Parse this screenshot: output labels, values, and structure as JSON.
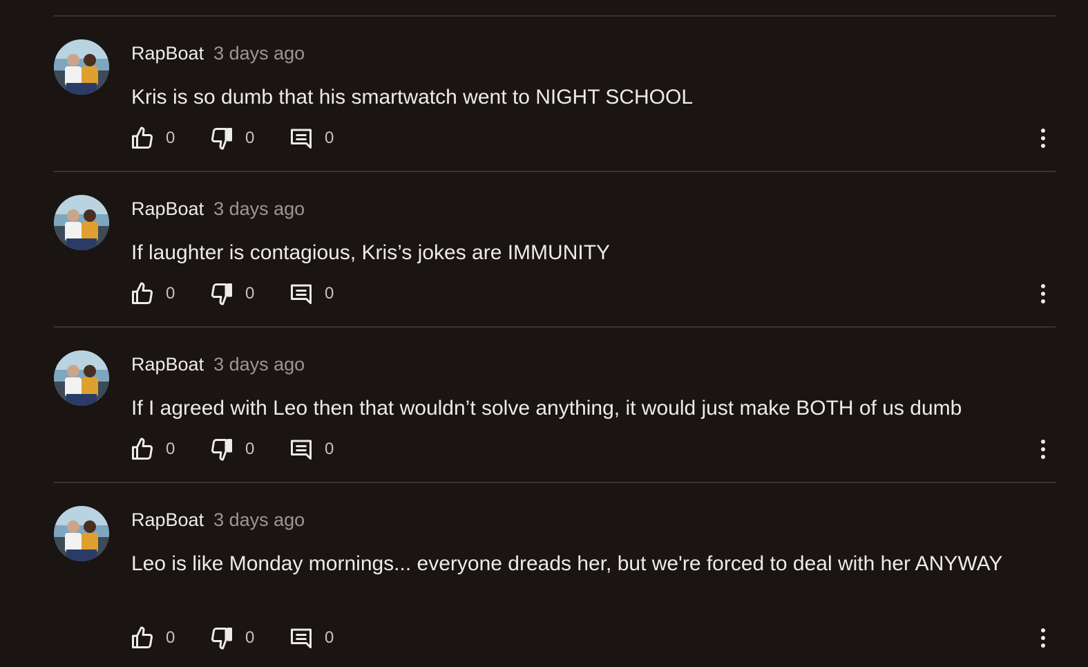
{
  "comments": [
    {
      "author": "RapBoat",
      "time": "3 days ago",
      "text": "Kris is so dumb that his smartwatch went to NIGHT SCHOOL",
      "likes": "0",
      "dislikes": "0",
      "replies": "0"
    },
    {
      "author": "RapBoat",
      "time": "3 days ago",
      "text": "If laughter is contagious, Kris’s jokes are IMMUNITY",
      "likes": "0",
      "dislikes": "0",
      "replies": "0"
    },
    {
      "author": "RapBoat",
      "time": "3 days ago",
      "text": "If I agreed with Leo then that wouldn’t solve anything, it would just make BOTH of us dumb",
      "likes": "0",
      "dislikes": "0",
      "replies": "0"
    },
    {
      "author": "RapBoat",
      "time": "3 days ago",
      "text": "Leo is like Monday mornings... everyone dreads her, but we're forced to deal with her ANYWAY",
      "likes": "0",
      "dislikes": "0",
      "replies": "0"
    }
  ],
  "icons": {
    "like": "thumb-up-icon",
    "dislike": "thumb-down-icon",
    "reply": "comment-icon",
    "more": "more-vertical-icon"
  },
  "colors": {
    "background": "#1a1412",
    "divider": "#3a3331",
    "text": "#ececec",
    "muted": "#9c9694"
  }
}
